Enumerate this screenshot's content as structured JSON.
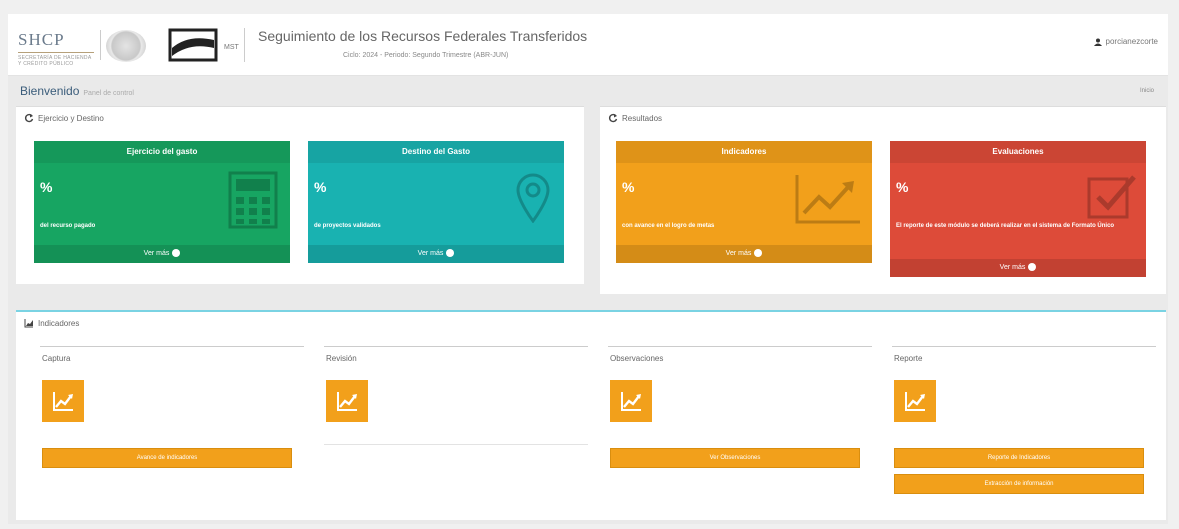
{
  "header": {
    "shcp_logo": "SHCP",
    "shcp_logo_sub": "SECRETARÍA DE HACIENDA Y CRÉDITO PÚBLICO",
    "mst_label": "MST",
    "title": "Seguimiento de los Recursos Federales Transferidos",
    "subtitle": "Ciclo: 2024 - Periodo: Segundo Trimestre (ABR-JUN)",
    "user": "porcianezcorte"
  },
  "welcome": {
    "title": "Bienvenido",
    "subtitle": "Panel de control",
    "home": "Inicio"
  },
  "ejercicio": {
    "title": "Ejercicio y Destino",
    "cards": [
      {
        "header": "Ejercicio del gasto",
        "value": "%",
        "desc": "del recurso pagado",
        "more": "Ver más",
        "color": "#17a562"
      },
      {
        "header": "Destino del Gasto",
        "value": "%",
        "desc": "de proyectos validados",
        "more": "Ver más",
        "color": "#19b2b1"
      }
    ]
  },
  "resultados": {
    "title": "Resultados",
    "cards": [
      {
        "header": "Indicadores",
        "value": "%",
        "desc": "con avance en el logro de metas",
        "more": "Ver más",
        "color": "#f2a01b"
      },
      {
        "header": "Evaluaciones",
        "value": "%",
        "desc": "El reporte de este módulo se deberá realizar en el sistema de Formato Único",
        "more": "Ver más",
        "color": "#dd4b39"
      }
    ]
  },
  "indicadores": {
    "title": "Indicadores",
    "columns": [
      {
        "title": "Captura",
        "buttons": [
          "Avance de indicadores"
        ]
      },
      {
        "title": "Revisión",
        "buttons": []
      },
      {
        "title": "Observaciones",
        "buttons": [
          "Ver Observaciones"
        ]
      },
      {
        "title": "Reporte",
        "buttons": [
          "Reporte de Indicadores",
          "Extracción de información"
        ]
      }
    ]
  }
}
